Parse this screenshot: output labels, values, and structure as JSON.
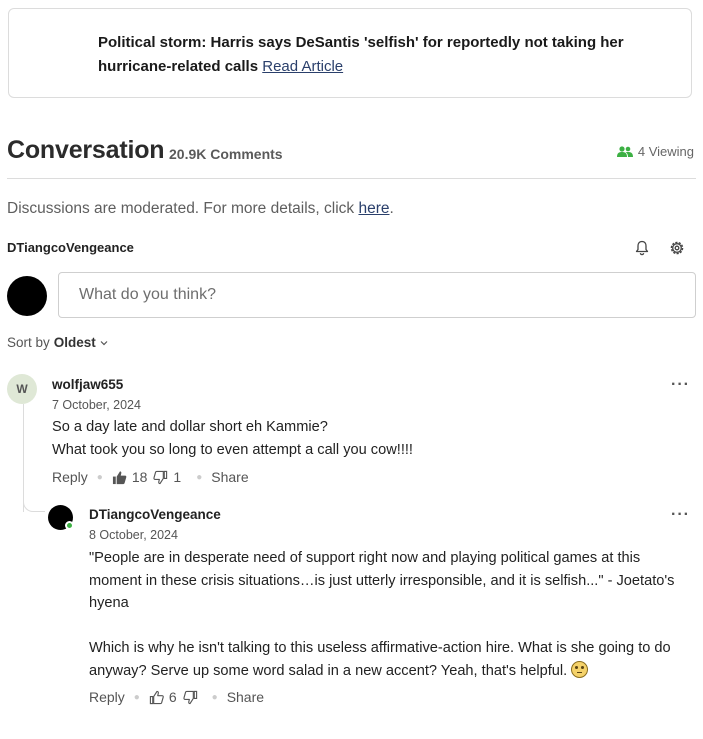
{
  "article": {
    "headline": "Political storm: Harris says DeSantis 'selfish' for reportedly not taking her hurricane-related calls",
    "link_label": "Read Article"
  },
  "conversation": {
    "title": "Conversation",
    "comment_count": "20.9K Comments",
    "viewing": "4 Viewing",
    "moderation_text": "Discussions are moderated. For more details, click ",
    "moderation_link": "here",
    "moderation_end": ".",
    "current_user": "DTiangcoVengeance",
    "input_placeholder": "What do you think?",
    "sort_label": "Sort by",
    "sort_value": "Oldest"
  },
  "comments": [
    {
      "avatar_letter": "W",
      "user": "wolfjaw655",
      "date": "7 October, 2024",
      "lines": [
        "So a day late and dollar short eh Kammie?",
        "What took you so long to even attempt a call you cow!!!!"
      ],
      "reply_label": "Reply",
      "likes": "18",
      "dislikes": "1",
      "share_label": "Share"
    },
    {
      "user": "DTiangcoVengeance",
      "date": "8 October, 2024",
      "paragraph1": "\"People are in desperate need of support right now and playing political games at this moment in these crisis situations…is just utterly irresponsible, and it is selfish...\" - Joetato's hyena",
      "paragraph2": "Which is why he isn't talking to this useless affirmative-action hire. What is she going to do anyway? Serve up some word salad in a new accent? Yeah, that's helpful.",
      "emoji": "face-with-rolling-eyes",
      "reply_label": "Reply",
      "likes": "6",
      "share_label": "Share"
    }
  ],
  "colors": {
    "link": "#2a3f6b",
    "online": "#3cb043",
    "viewing_icon": "#3cb043",
    "avatar_w_bg": "#dfe8d6"
  }
}
